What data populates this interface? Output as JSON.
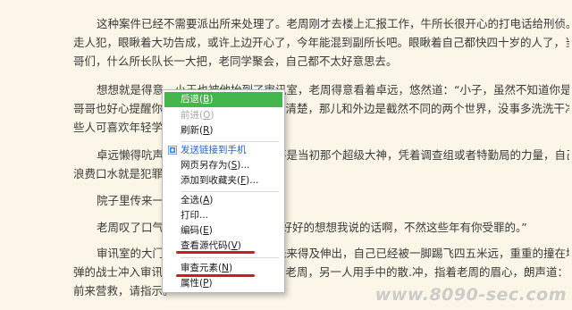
{
  "article": {
    "lines": [
      "",
      "这种案件已经不需要派出所来处理了。老周刚才去楼上汇报工作，牛所长很开心的打电话给刑侦。那边表示要亲自来带",
      "走人犯，眼瞅着大功告成，或许上边开心了，今年能混到副所长吧。眼瞅着自己都快四十岁的人了，当年一起从警校毕业的",
      "哥们，什么所长队长一大把，老同学聚会，自己都不太好意思去。",
      "想想就是得意，小王也被他抬到了审讯室，老周得意看着卓远，悠然道：“小子，虽然不知道你是犯了什么傻，但老",
      "哥哥也好心提醒你一句，在这里有件事情看清楚，那儿和外边是截然不同的两个世界，没事多洗洗干净屁股，里边有",
      "些人可喜欢年轻学生，呵呵……”",
      "卓远懒得吭声，他知道自己现在已经不是当初那个超级大神，凭着调查组或者特勤局的力量，自己再跟这个混日子的警察",
      "浪费口水就是犯罪。",
      "院子里传来一声刹车",
      "老周叹了口气：“孩子，只是希望你能好好的想想我说的话啊，不然这些年有你受罪的。”",
      "审讯室的大门刚刚打开，老周的手还未来得及伸出，自己已经被一脚踢飞四五米远，重重的撞在墙上，转眼间，三名荷枪实",
      "弹的战士冲入审讯室，一人手持冲锋枪指着老周，另一人用手中的散.冲，指着老周的眉心，朗声道：“战刀十三小队奉命",
      "前来营救，请指示。”"
    ]
  },
  "context_menu": {
    "items": [
      {
        "label": "后退",
        "key": "B"
      },
      {
        "label": "前进",
        "key": "O"
      },
      {
        "label": "刷新",
        "key": "R"
      },
      {
        "label": "发送链接到手机",
        "key": ""
      },
      {
        "label": "网页另存为",
        "key": "S",
        "suffix": "..."
      },
      {
        "label": "添加到收藏夹",
        "key": "F",
        "suffix": "..."
      },
      {
        "label": "全选",
        "key": "A"
      },
      {
        "label": "打印",
        "key": "",
        "suffix": "..."
      },
      {
        "label": "编码",
        "key": "E"
      },
      {
        "label": "查看源代码",
        "key": "V"
      },
      {
        "label": "审查元素",
        "key": "N"
      },
      {
        "label": "属性",
        "key": "P"
      }
    ],
    "colors": {
      "highlight": "#42b64a",
      "annotation_red": "#d21b1b"
    }
  },
  "watermark": "www.8090-sec.com"
}
